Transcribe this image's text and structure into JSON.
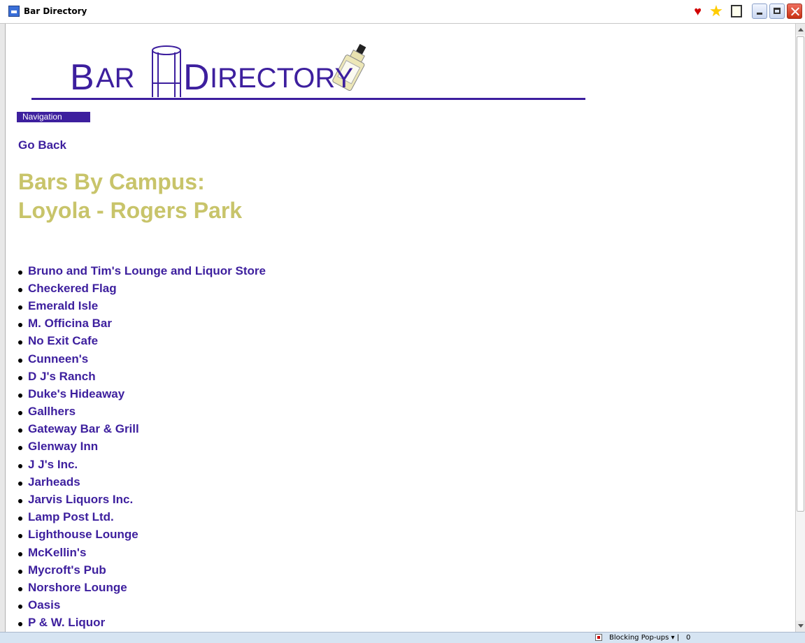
{
  "window": {
    "title": "Bar Directory"
  },
  "toolbar_icons": [
    "heart-icon",
    "star-icon",
    "note-icon"
  ],
  "logo": {
    "text_b": "B",
    "text_ar": "AR",
    "text_d": "D",
    "text_irectory": "IRECTORY"
  },
  "nav": {
    "header": "Navigation",
    "go_back": "Go Back"
  },
  "page": {
    "heading_line1": "Bars By Campus:",
    "heading_line2": "Loyola - Rogers Park"
  },
  "bars": [
    "Bruno and Tim's Lounge and Liquor Store",
    "Checkered Flag",
    "Emerald Isle",
    "M. Officina Bar",
    "No Exit Cafe",
    "Cunneen's",
    "D J's Ranch",
    "Duke's Hideaway",
    "Gallhers",
    "Gateway Bar & Grill",
    "Glenway Inn",
    "J J's Inc.",
    "Jarheads",
    "Jarvis Liquors Inc.",
    "Lamp Post Ltd.",
    "Lighthouse Lounge",
    "McKellin's",
    "Mycroft's Pub",
    "Norshore Lounge",
    "Oasis",
    "P & W. Liquor"
  ],
  "statusbar": {
    "popup_text": "Blocking Pop-ups ▾ |",
    "count": "0"
  },
  "colors": {
    "brand": "#3d1f9e",
    "heading": "#c8c46a",
    "statusbar": "#d6e4f2"
  }
}
